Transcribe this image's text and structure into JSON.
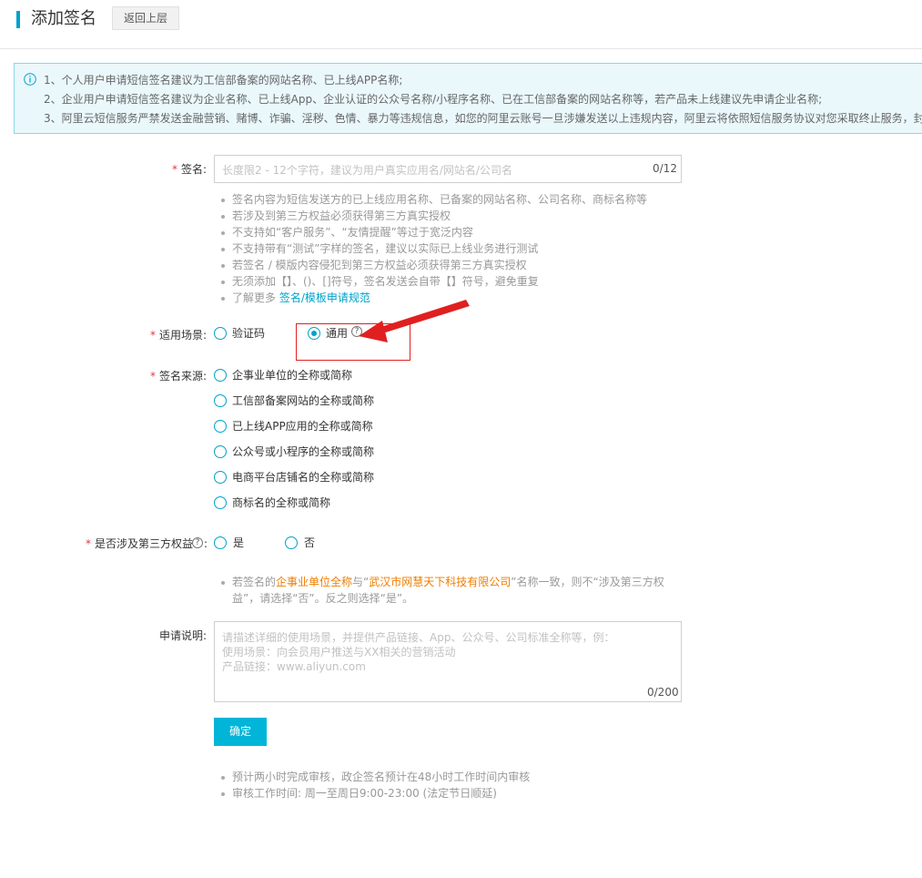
{
  "header": {
    "title": "添加签名",
    "back_label": "返回上层"
  },
  "notice": {
    "lines": [
      "1、个人用户申请短信签名建议为工信部备案的网站名称、已上线APP名称;",
      "2、企业用户申请短信签名建议为企业名称、已上线App、企业认证的公众号名称/小程序名称、已在工信部备案的网站名称等，若产品未上线建议先申请企业名称;",
      "3、阿里云短信服务严禁发送金融营销、赌博、诈骗、淫秽、色情、暴力等违规信息，如您的阿里云账号一旦涉嫌发送以上违规内容，阿里云将依照短信服务协议对您采取终止服务，封"
    ]
  },
  "signature": {
    "label": "签名:",
    "placeholder": "长度限2 - 12个字符，建议为用户真实应用名/网站名/公司名",
    "counter": "0/12",
    "hints": [
      "签名内容为短信发送方的已上线应用名称、已备案的网站名称、公司名称、商标名称等",
      "若涉及到第三方权益必须获得第三方真实授权",
      "不支持如“客户服务”、“友情提醒”等过于宽泛内容",
      "不支持带有“测试”字样的签名，建议以实际已上线业务进行测试",
      "若签名 / 模版内容侵犯到第三方权益必须获得第三方真实授权",
      "无须添加【】、()、[]符号，签名发送会自带【】符号，避免重复"
    ],
    "learn_more_prefix": "了解更多 ",
    "learn_more_link": "签名/模板申请规范"
  },
  "scenario": {
    "label": "适用场景:",
    "options": [
      "验证码",
      "通用"
    ],
    "selected": "通用"
  },
  "source": {
    "label": "签名来源:",
    "options": [
      "企事业单位的全称或简称",
      "工信部备案网站的全称或简称",
      "已上线APP应用的全称或简称",
      "公众号或小程序的全称或简称",
      "电商平台店铺名的全称或简称",
      "商标名的全称或简称"
    ]
  },
  "third_party": {
    "label": "是否涉及第三方权益",
    "colon": ":",
    "options": [
      "是",
      "否"
    ],
    "note_prefix": "若签名的",
    "note_highlight1": "企事业单位全称",
    "note_mid1": "与“",
    "note_highlight2": "武汉市网慧天下科技有限公司",
    "note_mid2": "”名称一致，则不“涉及第三方权",
    "note_line2": "益”，请选择“否”。反之则选择“是”。"
  },
  "description": {
    "label": "申请说明:",
    "placeholder_lines": [
      "请描述详细的使用场景，并提供产品链接、App、公众号、公司标准全称等，例：",
      "使用场景：向会员用户推送与XX相关的营销活动",
      "产品链接：www.aliyun.com"
    ],
    "counter": "0/200"
  },
  "submit_label": "确定",
  "footer_notes": [
    "预计两小时完成审核，政企签名预计在48小时工作时间内审核",
    "审核工作时间: 周一至周日9:00-23:00 (法定节日顺延)"
  ],
  "colors": {
    "accent": "#00a2ca",
    "button": "#00b5d8",
    "required": "#e4393c",
    "highlight_box": "#e02020",
    "orange_text": "#ee7d00"
  }
}
